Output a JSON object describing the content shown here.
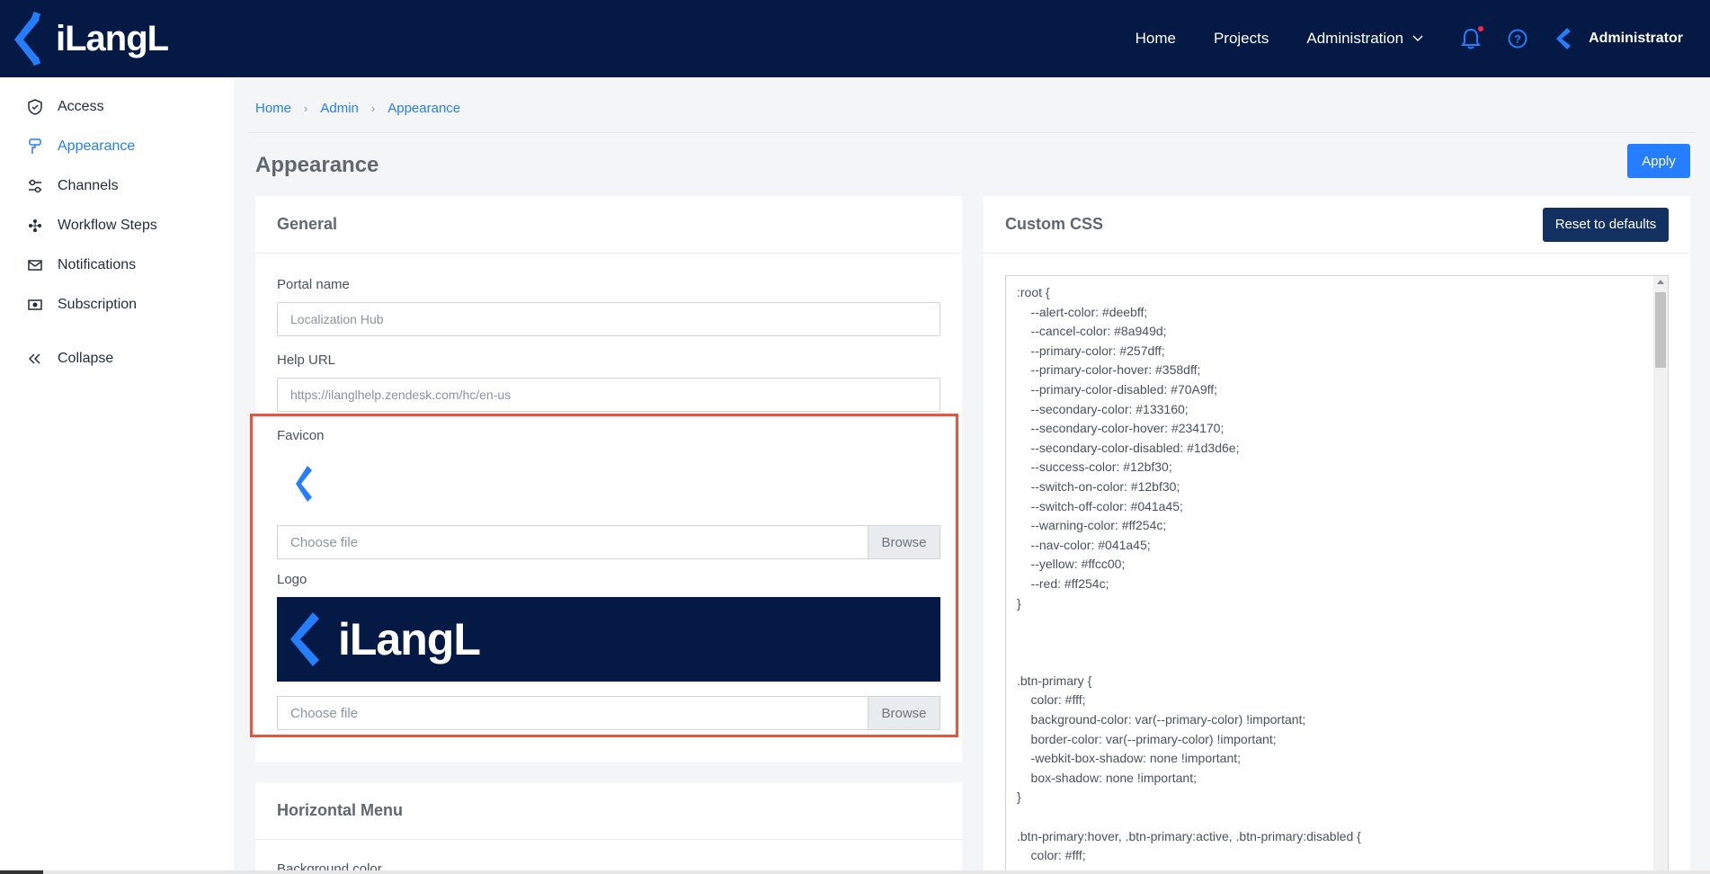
{
  "brand": {
    "name": "iLangL"
  },
  "topnav": {
    "home": "Home",
    "projects": "Projects",
    "administration": "Administration",
    "user": "Administrator"
  },
  "sidebar": {
    "items": [
      {
        "label": "Access",
        "icon": "shield-check-icon"
      },
      {
        "label": "Appearance",
        "icon": "paint-brush-icon"
      },
      {
        "label": "Channels",
        "icon": "sliders-icon"
      },
      {
        "label": "Workflow Steps",
        "icon": "workflow-icon"
      },
      {
        "label": "Notifications",
        "icon": "mail-icon"
      },
      {
        "label": "Subscription",
        "icon": "money-icon"
      }
    ],
    "collapse": "Collapse"
  },
  "breadcrumb": {
    "home": "Home",
    "admin": "Admin",
    "current": "Appearance"
  },
  "page": {
    "title": "Appearance",
    "apply": "Apply"
  },
  "general": {
    "title": "General",
    "portal_name_label": "Portal name",
    "portal_name_value": "Localization Hub",
    "help_url_label": "Help URL",
    "help_url_value": "https://ilanglhelp.zendesk.com/hc/en-us",
    "favicon_label": "Favicon",
    "favicon_file": "Choose file",
    "browse": "Browse",
    "logo_label": "Logo",
    "logo_file": "Choose file"
  },
  "hmenu": {
    "title": "Horizontal Menu",
    "bg_label": "Background color"
  },
  "custom_css": {
    "title": "Custom CSS",
    "reset": "Reset to defaults",
    "code": ":root {\n    --alert-color: #deebff;\n    --cancel-color: #8a949d;\n    --primary-color: #257dff;\n    --primary-color-hover: #358dff;\n    --primary-color-disabled: #70A9ff;\n    --secondary-color: #133160;\n    --secondary-color-hover: #234170;\n    --secondary-color-disabled: #1d3d6e;\n    --success-color: #12bf30;\n    --switch-on-color: #12bf30;\n    --switch-off-color: #041a45;\n    --warning-color: #ff254c;\n    --nav-color: #041a45;\n    --yellow: #ffcc00;\n    --red: #ff254c;\n}\n\n\n\n.btn-primary {\n    color: #fff;\n    background-color: var(--primary-color) !important;\n    border-color: var(--primary-color) !important;\n    -webkit-box-shadow: none !important;\n    box-shadow: none !important;\n}\n\n.btn-primary:hover, .btn-primary:active, .btn-primary:disabled {\n    color: #fff;\n    background-color: var(--primary-color-hover) !important;"
  },
  "colors": {
    "nav": "#041a45",
    "primary": "#257dff",
    "secondary": "#133160",
    "highlight": "#e8553f"
  }
}
